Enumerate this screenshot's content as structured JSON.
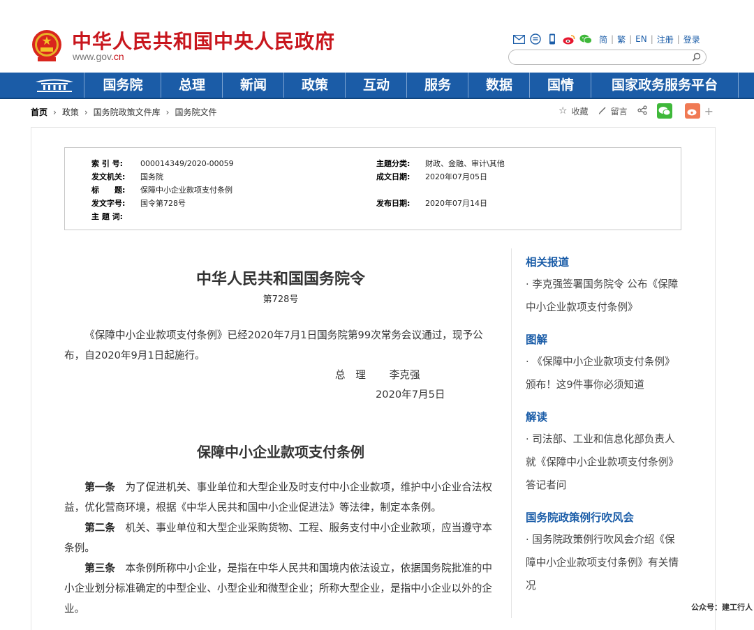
{
  "header": {
    "site_name": "中华人民共和国中央人民政府",
    "url_prefix": "www.gov",
    "url_suffix": ".cn",
    "languages": [
      "简",
      "繁",
      "EN",
      "注册",
      "登录"
    ],
    "icons": [
      "mail-icon",
      "message-icon",
      "mobile-icon",
      "weibo-icon",
      "wechat-icon"
    ],
    "search_placeholder": ""
  },
  "nav": {
    "items": [
      "国务院",
      "总理",
      "新闻",
      "政策",
      "互动",
      "服务",
      "数据",
      "国情",
      "国家政务服务平台"
    ]
  },
  "breadcrumb": {
    "items": [
      "首页",
      "政策",
      "国务院政策文件库",
      "国务院文件"
    ]
  },
  "share": {
    "favorite": "收藏",
    "comment": "留言"
  },
  "info": {
    "index_label": "索 引 号:",
    "index_value": "000014349/2020-00059",
    "category_label": "主题分类:",
    "category_value": "财政、金融、审计\\其他",
    "issuer_label": "发文机关:",
    "issuer_value": "国务院",
    "date_label": "成文日期:",
    "date_value": "2020年07月05日",
    "title_label": "标　　题:",
    "title_value": "保障中小企业款项支付条例",
    "docno_label": "发文字号:",
    "docno_value": "国令第728号",
    "publish_label": "发布日期:",
    "publish_value": "2020年07月14日",
    "keywords_label": "主 题 词:"
  },
  "document": {
    "order_title": "中华人民共和国国务院令",
    "order_number": "第728号",
    "intro": "《保障中小企业款项支付条例》已经2020年7月1日国务院第99次常务会议通过，现予公布，自2020年9月1日起施行。",
    "sign_role": "总　理",
    "sign_name": "李克强",
    "sign_date": "2020年7月5日",
    "regulation_title": "保障中小企业款项支付条例",
    "articles": [
      {
        "label": "第一条",
        "text": "为了促进机关、事业单位和大型企业及时支付中小企业款项，维护中小企业合法权益，优化营商环境，根据《中华人民共和国中小企业促进法》等法律，制定本条例。"
      },
      {
        "label": "第二条",
        "text": "机关、事业单位和大型企业采购货物、工程、服务支付中小企业款项，应当遵守本条例。"
      },
      {
        "label": "第三条",
        "text": "本条例所称中小企业，是指在中华人民共和国境内依法设立，依据国务院批准的中小企业划分标准确定的中型企业、小型企业和微型企业；所称大型企业，是指中小企业以外的企业。"
      }
    ]
  },
  "sidebar": {
    "sections": [
      {
        "heading": "相关报道",
        "item": "· 李克强签署国务院令 公布《保障中小企业款项支付条例》"
      },
      {
        "heading": "图解",
        "item": "· 《保障中小企业款项支付条例》颁布！这9件事你必须知道"
      },
      {
        "heading": "解读",
        "item": "· 司法部、工业和信息化部负责人就《保障中小企业款项支付条例》答记者问"
      },
      {
        "heading": "国务院政策例行吹风会",
        "item": "· 国务院政策例行吹风会介绍《保障中小企业款项支付条例》有关情况"
      }
    ]
  },
  "watermark": "公众号：建工行人",
  "colors": {
    "brand_red": "#c8161d",
    "nav_blue": "#1b5ca7",
    "link_blue": "#1b5da8",
    "wechat_green": "#3fb83a",
    "weibo_orange": "#f07a54"
  }
}
